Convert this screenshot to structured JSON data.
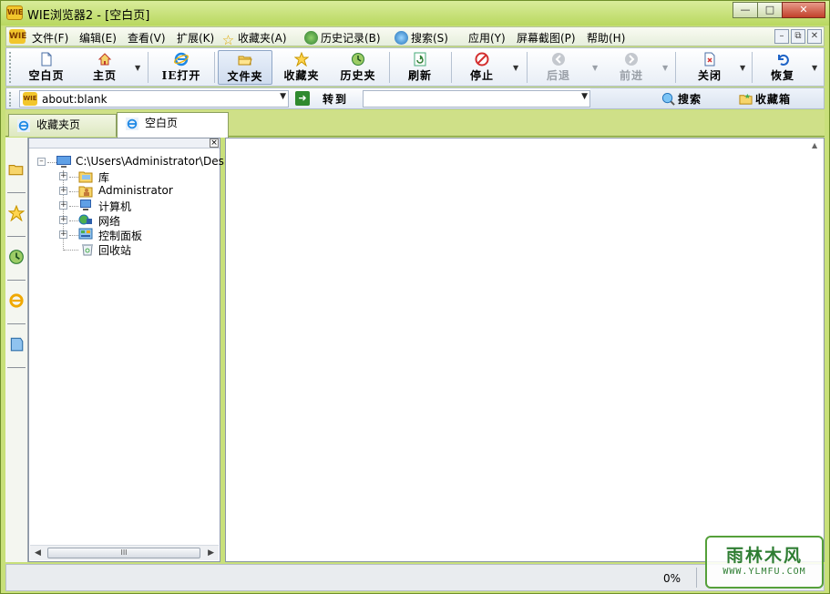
{
  "window": {
    "title": "WIE浏览器2 - [空白页]",
    "logo_text": "WIE",
    "controls": [
      "minimize",
      "maximize",
      "close"
    ]
  },
  "menubar": {
    "items": [
      {
        "label": "文件(F)",
        "icon": null
      },
      {
        "label": "编辑(E)",
        "icon": null
      },
      {
        "label": "查看(V)",
        "icon": null
      },
      {
        "label": "扩展(K)",
        "icon": null
      },
      {
        "label": "收藏夹(A)",
        "icon": "star-icon"
      },
      {
        "label": "历史记录(B)",
        "icon": "history-icon"
      },
      {
        "label": "搜索(S)",
        "icon": "search-globe-icon"
      },
      {
        "label": "应用(Y)",
        "icon": null
      },
      {
        "label": "屏幕截图(P)",
        "icon": null
      },
      {
        "label": "帮助(H)",
        "icon": null
      }
    ]
  },
  "toolbar": {
    "buttons": [
      {
        "label": "空白页",
        "icon": "blank-page-icon",
        "dropdown": false,
        "disabled": false,
        "active": false
      },
      {
        "label": "主页",
        "icon": "home-icon",
        "dropdown": true,
        "disabled": false,
        "active": false
      },
      {
        "label": "IE打开",
        "icon": "ie-icon",
        "dropdown": false,
        "disabled": false,
        "active": false
      },
      {
        "label": "文件夹",
        "icon": "folder-icon",
        "dropdown": false,
        "disabled": false,
        "active": true
      },
      {
        "label": "收藏夹",
        "icon": "star-icon",
        "dropdown": false,
        "disabled": false,
        "active": false
      },
      {
        "label": "历史夹",
        "icon": "history-icon",
        "dropdown": false,
        "disabled": false,
        "active": false
      },
      {
        "label": "刷新",
        "icon": "refresh-icon",
        "dropdown": false,
        "disabled": false,
        "active": false
      },
      {
        "label": "停止",
        "icon": "stop-icon",
        "dropdown": true,
        "disabled": false,
        "active": false
      },
      {
        "label": "后退",
        "icon": "back-icon",
        "dropdown": true,
        "disabled": true,
        "active": false
      },
      {
        "label": "前进",
        "icon": "forward-icon",
        "dropdown": true,
        "disabled": true,
        "active": false
      },
      {
        "label": "关闭",
        "icon": "close-page-icon",
        "dropdown": true,
        "disabled": false,
        "active": false
      },
      {
        "label": "恢复",
        "icon": "undo-icon",
        "dropdown": true,
        "disabled": false,
        "active": false
      }
    ]
  },
  "addressbar": {
    "url": "about:blank",
    "go_label": "转到",
    "search_value": "",
    "search_button": "搜索",
    "favorites_button": "收藏箱"
  },
  "tabs": [
    {
      "label": "收藏夹页",
      "active": false
    },
    {
      "label": "空白页",
      "active": true
    }
  ],
  "left_strip": [
    "folder-icon",
    "star-icon",
    "history-icon",
    "ie-icon",
    "notes-icon"
  ],
  "tree": {
    "root": "C:\\Users\\Administrator\\Desktop",
    "children": [
      {
        "label": "库",
        "icon": "library-icon",
        "expandable": true
      },
      {
        "label": "Administrator",
        "icon": "user-folder-icon",
        "expandable": true
      },
      {
        "label": "计算机",
        "icon": "computer-icon",
        "expandable": true
      },
      {
        "label": "网络",
        "icon": "network-icon",
        "expandable": true
      },
      {
        "label": "控制面板",
        "icon": "control-panel-icon",
        "expandable": true
      },
      {
        "label": "回收站",
        "icon": "recycle-bin-icon",
        "expandable": false
      }
    ],
    "hscroll_grip": "III"
  },
  "status": {
    "progress": "0%"
  },
  "watermark": {
    "top": "雨林木风",
    "bottom": "WWW.YLMFU.COM"
  },
  "colors": {
    "frame": "#c8e07a",
    "accent": "#2e7d32"
  }
}
